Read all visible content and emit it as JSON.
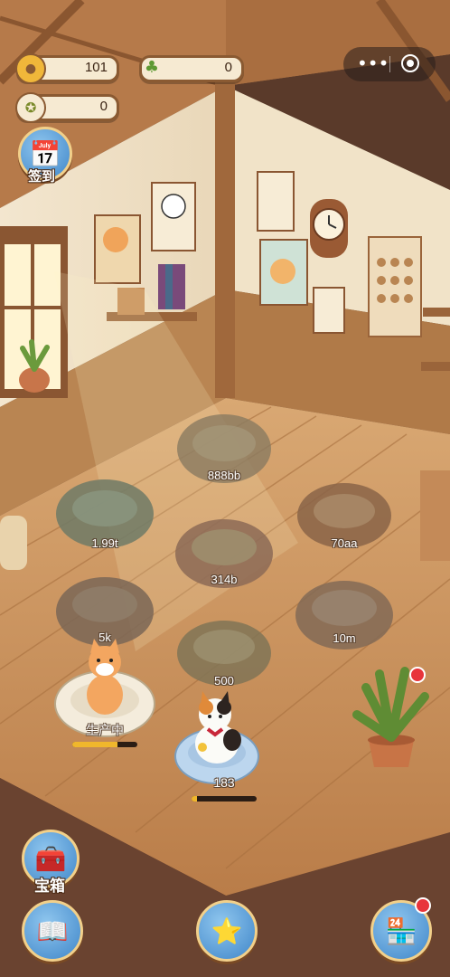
{
  "resources": {
    "coins": "101",
    "grass": "0",
    "medals": "0"
  },
  "buttons": {
    "checkin": "签到",
    "chest": "宝箱"
  },
  "beds": [
    {
      "label": "888bb"
    },
    {
      "label": "1.99t"
    },
    {
      "label": "314b"
    },
    {
      "label": "70aa"
    },
    {
      "label": "5k"
    },
    {
      "label": "500"
    },
    {
      "label": "10m"
    }
  ],
  "cats": [
    {
      "status": "生产中",
      "progress": 0.7
    },
    {
      "status": "183",
      "progress": 0.08
    }
  ],
  "colors": {
    "accent": "#3f86c9",
    "progress": "#f0b72c",
    "badge": "#e8343a"
  }
}
